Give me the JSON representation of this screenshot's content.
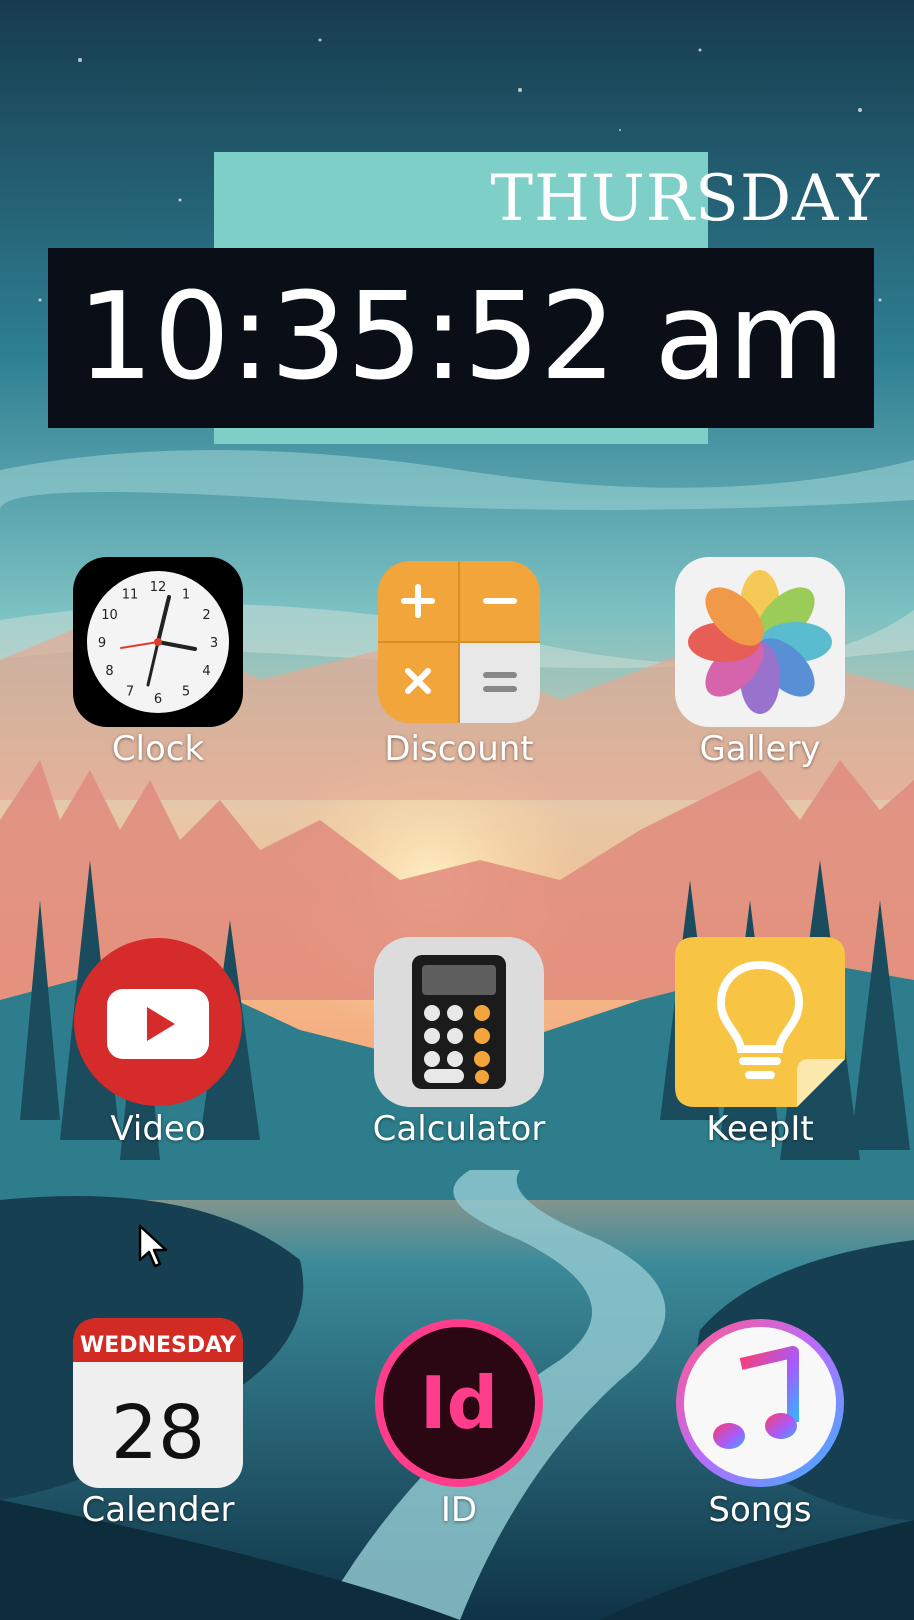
{
  "widget": {
    "day": "THURSDAY",
    "time": "10:35:52 am"
  },
  "apps": [
    {
      "label": "Clock",
      "icon": "clock-icon"
    },
    {
      "label": "Discount",
      "icon": "discount-calculator-icon"
    },
    {
      "label": "Gallery",
      "icon": "gallery-icon"
    },
    {
      "label": "Video",
      "icon": "video-play-icon"
    },
    {
      "label": "Calculator",
      "icon": "calculator-icon"
    },
    {
      "label": "KeepIt",
      "icon": "lightbulb-note-icon"
    },
    {
      "label": "Calender",
      "icon": "calendar-icon",
      "badge_day": "WEDNESDAY",
      "badge_date": "28"
    },
    {
      "label": "ID",
      "icon": "indesign-icon",
      "glyph": "Id"
    },
    {
      "label": "Songs",
      "icon": "music-note-icon"
    }
  ],
  "colors": {
    "widget_accent": "#7ecfc8",
    "time_box": "#0a0f17",
    "video_red": "#d62b2b",
    "discount_orange": "#f2a53a",
    "keepit_yellow": "#f7c543",
    "indesign_pink": "#ff3d8b"
  },
  "clock_face": [
    "12",
    "1",
    "2",
    "3",
    "4",
    "5",
    "6",
    "7",
    "8",
    "9",
    "10",
    "11"
  ]
}
